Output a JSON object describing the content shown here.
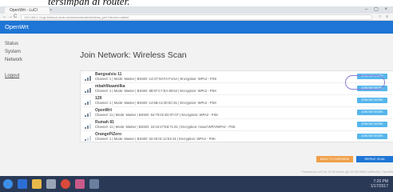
{
  "caption": {
    "text": "tersimpan di router."
  },
  "browser": {
    "tab_title": "OpenWrt - LuCI",
    "tab_close": "×",
    "window_controls": "– ▢ ×",
    "back": "←",
    "forward": "→",
    "reload": "C",
    "url": "192.168.1.1/cgi-bin/luci/;stok=/admin/network/wireless_join?device=radio0",
    "addr_icons": "☆ ≡"
  },
  "header": {
    "brand": "OpenWrt"
  },
  "sidebar": {
    "items": [
      {
        "label": "Status"
      },
      {
        "label": "System"
      },
      {
        "label": "Network"
      }
    ],
    "logout": "Logout"
  },
  "main": {
    "title": "Join Network: Wireless Scan",
    "networks": [
      {
        "name": "Bangsalsiu 11",
        "detail": "Channel: 1 | Mode: Master | BSSID: 14:CF:92:FA:F4:5A | Encryption: WPA2 - PSK",
        "join": "JOIN NETWORK",
        "signal": 3
      },
      {
        "name": "mbahfikaamilka",
        "detail": "Channel: 1 | Mode: Master | BSSID: 88:97:C7:EA:80:62 | Encryption: WPA2 - PSK",
        "join": "JOIN NETWORK",
        "signal": 3
      },
      {
        "name": "129",
        "detail": "Channel: 1 | Mode: Master | BSSID: 14:5B:A2:30:0C:91 | Encryption: WPA2 - PSK",
        "join": "JOIN NETWORK",
        "signal": 2
      },
      {
        "name": "OpenWrt",
        "detail": "Channel: 11 | Mode: Master | BSSID: 64:70:02:4D:07:CF | Encryption: WPA2 - PSK",
        "join": "JOIN NETWORK",
        "signal": 2
      },
      {
        "name": "Rumah 81",
        "detail": "Channel: 11 | Mode: Master | BSSID: 24:44:27:E8:71:91 | Encryption: mixed WPA/WPA2 - PSK",
        "join": "JOIN NETWORK",
        "signal": 2
      },
      {
        "name": "OrangePiZero",
        "detail": "Channel: 1 | Mode: Master | BSSID: 02:40:01:12:E2:31 | Encryption: WPA2 - PSK",
        "join": "JOIN NETWORK",
        "signal": 1
      }
    ],
    "back_button": "BACK TO OVERVIEW",
    "repeat_button": "REPEAT SCAN",
    "footer": "Powered by LuCI for-15.05 branch (git-16.294.59815-c09ecd3) / OpenWrt"
  },
  "taskbar": {
    "time": "7:26 PM",
    "date": "1/17/2017"
  },
  "colors": {
    "accent": "#1e75d5",
    "join_button": "#55b6ec",
    "back_button": "#f0a04a",
    "highlight_ring": "#8a7dd8",
    "taskbar": "#2a3a56"
  }
}
